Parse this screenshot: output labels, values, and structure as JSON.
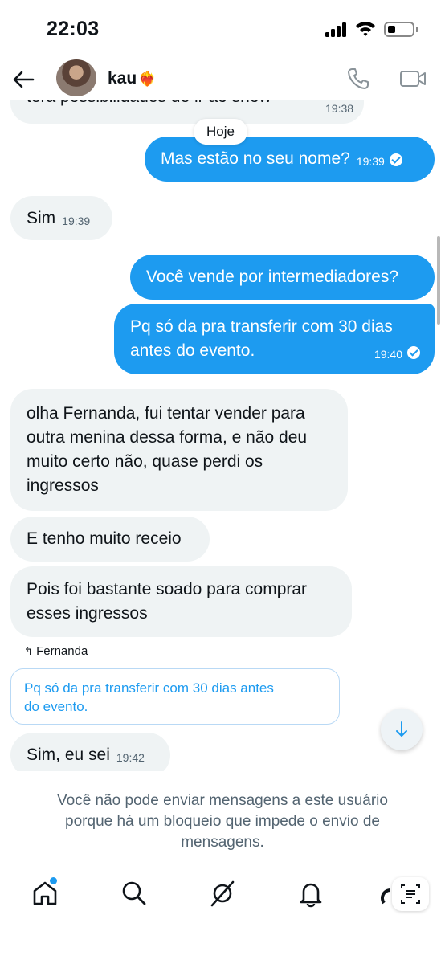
{
  "status_bar": {
    "time": "22:03"
  },
  "header": {
    "contact_name": "kau",
    "name_emoji": "❤️‍🔥"
  },
  "conversation": {
    "partial_message": {
      "text": "tera possibilidades de ir ao show",
      "time": "19:38"
    },
    "day_separator": "Hoje",
    "messages": [
      {
        "direction": "out",
        "text": "Mas estão no seu nome?",
        "time": "19:39"
      },
      {
        "direction": "in",
        "text": "Sim",
        "time": "19:39"
      },
      {
        "direction": "out",
        "text": "Você vende por intermediadores?"
      },
      {
        "direction": "out",
        "text_lines": [
          "Pq só da pra transferir com 30 dias",
          "antes do evento."
        ],
        "time": "19:40"
      },
      {
        "direction": "in",
        "text_lines": [
          "olha Fernanda, fui tentar vender para",
          "outra menina dessa forma, e não deu",
          "muito certo não, quase perdi os",
          "ingressos"
        ]
      },
      {
        "direction": "in",
        "text": "E tenho muito receio"
      },
      {
        "direction": "in",
        "text_lines": [
          "Pois foi bastante soado para comprar",
          "esses ingressos"
        ]
      },
      {
        "direction": "in",
        "text": "Sim, eu sei",
        "time": "19:42"
      }
    ],
    "reply": {
      "label": "Fernanda",
      "quote_lines": [
        "Pq só da pra transferir com 30 dias antes",
        "do evento."
      ]
    }
  },
  "blocked_notice_lines": [
    "Você não pode enviar mensagens a este usuário",
    "porque há um bloqueio que impede o envio de",
    "mensagens."
  ],
  "bottom_nav": {
    "items": [
      "home-icon",
      "search-icon",
      "grok-icon",
      "bell-icon",
      "scan-icon"
    ]
  },
  "colors": {
    "accent": "#1d9bf0",
    "incoming_bubble": "#eff3f4",
    "muted_text": "#536471"
  }
}
